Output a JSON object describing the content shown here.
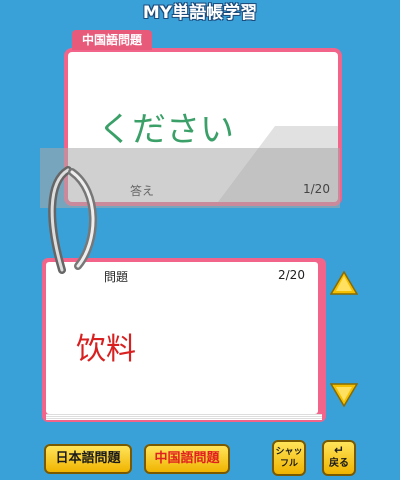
{
  "app": {
    "title": "MY単語帳学習"
  },
  "top_card": {
    "tab_label": "中国語問題",
    "word": "ください",
    "answer_label": "答え",
    "counter": "1/20",
    "word_color": "#3aa068"
  },
  "bottom_card": {
    "question_label": "問題",
    "counter": "2/20",
    "word": "饮料",
    "word_color": "#d82020"
  },
  "buttons": {
    "japanese_question": "日本語問題",
    "chinese_question": "中国語問題",
    "shuffle_line1": "シャッ",
    "shuffle_line2": "フル",
    "back": "戻る"
  },
  "icons": {
    "up": "arrow-up-icon",
    "down": "arrow-down-icon",
    "back": "return-arrow-icon"
  },
  "colors": {
    "background": "#3aa0d8",
    "card_border": "#f3648a",
    "button_yellow": "#ffd22a"
  }
}
